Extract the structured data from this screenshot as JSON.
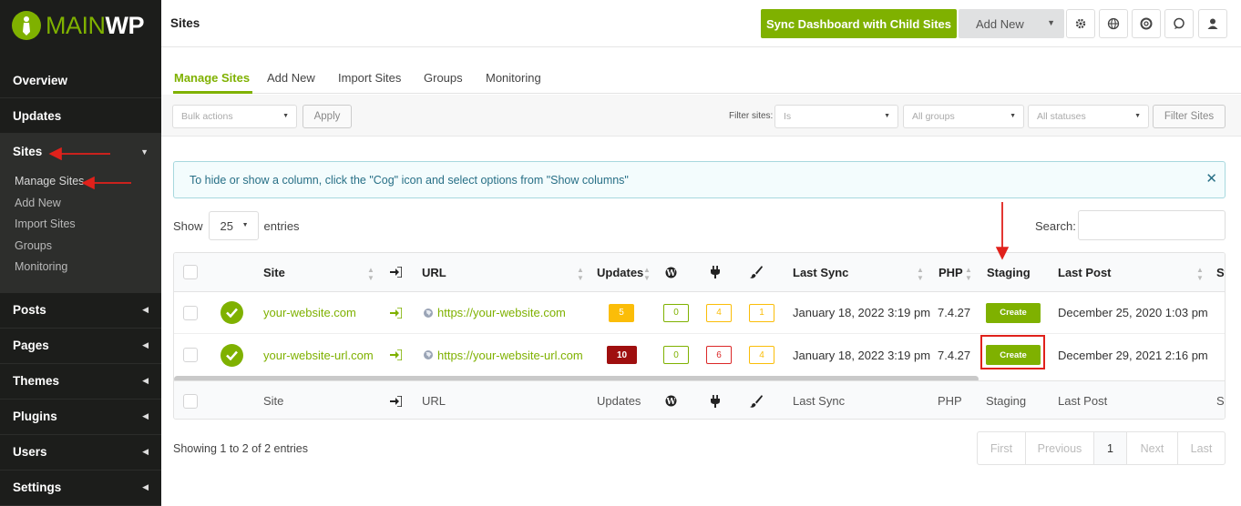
{
  "logo": {
    "text_main": "MAIN",
    "text_wp": "WP"
  },
  "sidebar": {
    "items": [
      {
        "label": "Overview"
      },
      {
        "label": "Updates"
      },
      {
        "label": "Sites"
      },
      {
        "label": "Posts"
      },
      {
        "label": "Pages"
      },
      {
        "label": "Themes"
      },
      {
        "label": "Plugins"
      },
      {
        "label": "Users"
      },
      {
        "label": "Settings"
      }
    ],
    "sites_submenu": [
      "Manage Sites",
      "Add New",
      "Import Sites",
      "Groups",
      "Monitoring"
    ]
  },
  "header": {
    "title": "Sites",
    "sync_button": "Sync Dashboard with Child Sites",
    "add_new_button": "Add New"
  },
  "tabs": [
    "Manage Sites",
    "Add New",
    "Import Sites",
    "Groups",
    "Monitoring"
  ],
  "filters": {
    "bulk_actions": "Bulk actions",
    "apply": "Apply",
    "filter_label": "Filter sites:",
    "is": "Is",
    "groups": "All groups",
    "statuses": "All statuses",
    "filter_button": "Filter Sites"
  },
  "info_message": "To hide or show a column, click the \"Cog\" icon and select options from \"Show columns\"",
  "show_entries": {
    "show": "Show",
    "value": "25",
    "entries": "entries",
    "search_label": "Search:"
  },
  "table": {
    "headers": {
      "site": "Site",
      "url": "URL",
      "updates": "Updates",
      "last_sync": "Last Sync",
      "php": "PHP",
      "staging": "Staging",
      "last_post": "Last Post",
      "status_trunc": "St"
    },
    "rows": [
      {
        "site": "your-website.com",
        "url": "https://your-website.com",
        "updates": "5",
        "wp": "0",
        "plugins": "4",
        "themes": "1",
        "last_sync": "January 18, 2022 3:19 pm",
        "php": "7.4.27",
        "staging": "Create",
        "last_post": "December 25, 2020 1:03 pm"
      },
      {
        "site": "your-website-url.com",
        "url": "https://your-website-url.com",
        "updates": "10",
        "wp": "0",
        "plugins": "6",
        "themes": "4",
        "last_sync": "January 18, 2022 3:19 pm",
        "php": "7.4.27",
        "staging": "Create",
        "last_post": "December 29, 2021 2:16 pm"
      }
    ]
  },
  "footer": {
    "showing": "Showing 1 to 2 of 2 entries",
    "pager": [
      "First",
      "Previous",
      "1",
      "Next",
      "Last"
    ]
  },
  "colors": {
    "accent": "#7fb100",
    "sidebar": "#1c1d1b",
    "annotation": "#e0211b"
  }
}
